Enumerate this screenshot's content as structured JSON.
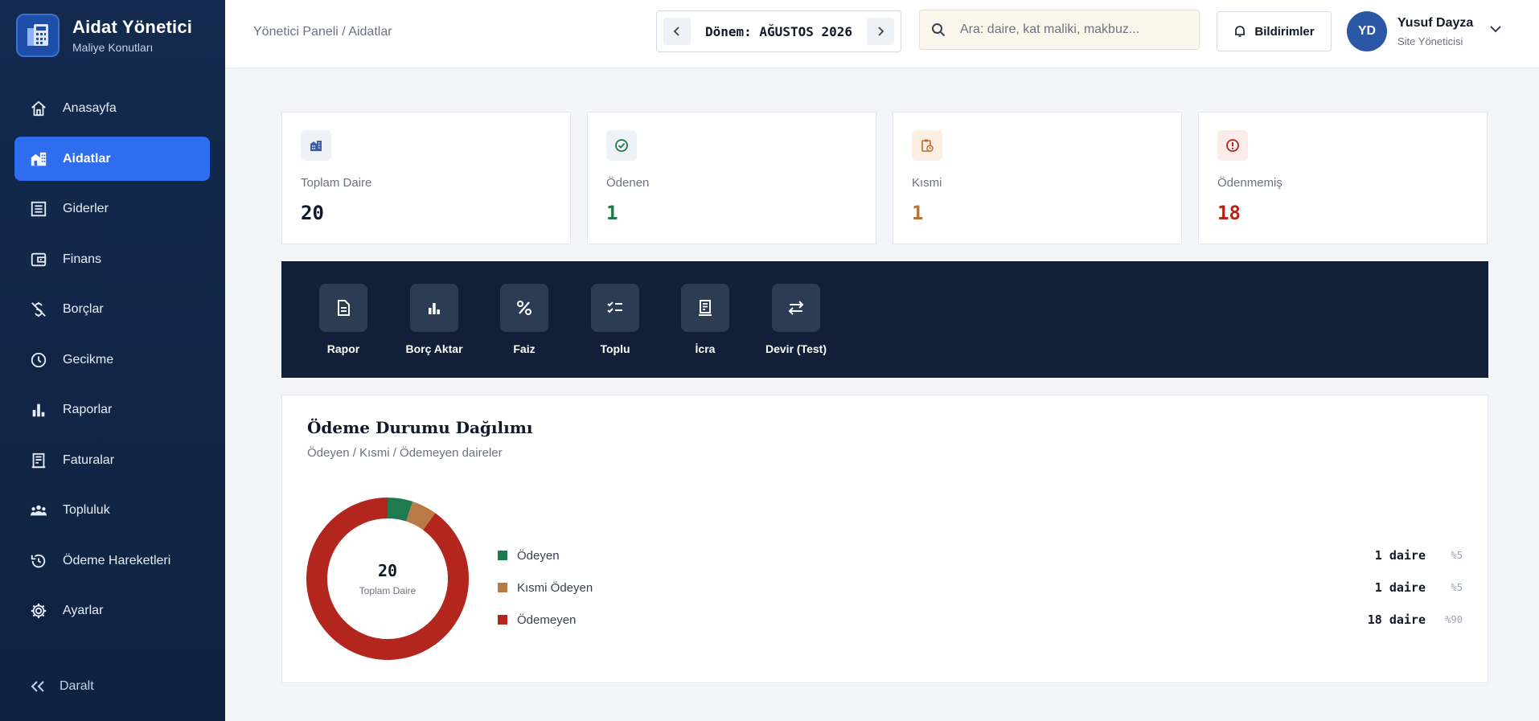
{
  "brand": {
    "title": "Aidat Yönetici",
    "subtitle": "Maliye Konutları"
  },
  "sidebar": {
    "items": [
      {
        "label": "Anasayfa",
        "icon": "home-icon"
      },
      {
        "label": "Aidatlar",
        "icon": "building-icon",
        "active": true
      },
      {
        "label": "Giderler",
        "icon": "receipt-icon"
      },
      {
        "label": "Finans",
        "icon": "wallet-icon"
      },
      {
        "label": "Borçlar",
        "icon": "money-off-icon"
      },
      {
        "label": "Gecikme",
        "icon": "clock-icon"
      },
      {
        "label": "Raporlar",
        "icon": "bar-chart-icon"
      },
      {
        "label": "Faturalar",
        "icon": "invoice-icon"
      },
      {
        "label": "Topluluk",
        "icon": "group-icon"
      },
      {
        "label": "Ödeme Hareketleri",
        "icon": "history-icon"
      },
      {
        "label": "Ayarlar",
        "icon": "gear-icon"
      }
    ],
    "collapse_label": "Daralt"
  },
  "header": {
    "breadcrumb": "Yönetici Paneli / Aidatlar",
    "period_label": "Dönem: AĞUSTOS 2026",
    "search_placeholder": "Ara: daire, kat maliki, makbuz...",
    "notifications_label": "Bildirimler",
    "user": {
      "initials": "YD",
      "name": "Yusuf Dayza",
      "role": "Site Yöneticisi"
    }
  },
  "summary": {
    "cards": [
      {
        "label": "Toplam Daire",
        "value": "20",
        "color": "#111827",
        "icon": "apartment-icon",
        "icon_bg": "#eef1f6",
        "icon_color": "#3b5fa8"
      },
      {
        "label": "Ödenen",
        "value": "1",
        "color": "#1f7a4d",
        "icon": "check-circle-icon",
        "icon_bg": "#eef1f6",
        "icon_color": "#1f7a4d"
      },
      {
        "label": "Kısmi",
        "value": "1",
        "color": "#b4733c",
        "icon": "clipboard-clock-icon",
        "icon_bg": "#fbeee3",
        "icon_color": "#c0692c"
      },
      {
        "label": "Ödenmemiş",
        "value": "18",
        "color": "#b3261e",
        "icon": "alert-circle-icon",
        "icon_bg": "#fbeceb",
        "icon_color": "#b3261e"
      }
    ]
  },
  "actions": [
    {
      "label": "Rapor",
      "icon": "document-icon"
    },
    {
      "label": "Borç Aktar",
      "icon": "bar-chart-icon"
    },
    {
      "label": "Faiz",
      "icon": "percent-icon"
    },
    {
      "label": "Toplu",
      "icon": "checklist-icon"
    },
    {
      "label": "İcra",
      "icon": "invoice-icon"
    },
    {
      "label": "Devir (Test)",
      "icon": "swap-icon"
    }
  ],
  "distribution": {
    "title": "Ödeme Durumu Dağılımı",
    "subtitle": "Ödeyen / Kısmi / Ödemeyen daireler",
    "center_value": "20",
    "center_label": "Toplam Daire",
    "rows": [
      {
        "name": "Ödeyen",
        "count": "1 daire",
        "pct": "%5",
        "color": "#1f7a4d"
      },
      {
        "name": "Kısmi Ödeyen",
        "count": "1 daire",
        "pct": "%5",
        "color": "#b97a45"
      },
      {
        "name": "Ödemeyen",
        "count": "18 daire",
        "pct": "%90",
        "color": "#b3261e"
      }
    ]
  },
  "chart_data": {
    "type": "pie",
    "categories": [
      "Ödeyen",
      "Kısmi Ödeyen",
      "Ödemeyen"
    ],
    "values": [
      1,
      1,
      18
    ],
    "colors": [
      "#1f7a4d",
      "#b97a45",
      "#b3261e"
    ],
    "title": "Ödeme Durumu Dağılımı",
    "subtitle": "Ödeyen / Kısmi / Ödemeyen daireler"
  }
}
